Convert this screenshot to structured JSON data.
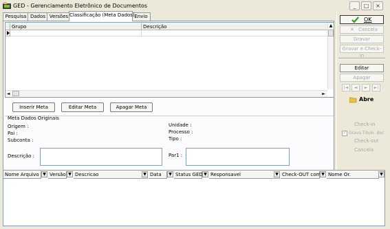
{
  "window": {
    "title": "GED - Gerenciamento Eletrônico de Documentos"
  },
  "tabs": [
    "Pesquisa",
    "Dados",
    "Versões",
    "Classificação (Meta Dados)",
    "Envio"
  ],
  "grid": {
    "columns": [
      "Grupo",
      "Descrição"
    ]
  },
  "meta_buttons": {
    "insert": "Inserir Meta",
    "edit": "Editar Meta",
    "delete": "Apagar Meta"
  },
  "meta_original": {
    "heading": "Meta Dados Originais",
    "origem": "Origem :",
    "pai": "Pai :",
    "subconta": "Subconta :",
    "unidade": "Unidade :",
    "processo": "Processo :",
    "tipo": "Tipo :",
    "descricao": "Descrição :",
    "par1": "Par1 :"
  },
  "right_panel": {
    "ok": "OK",
    "cancel": "Cancela",
    "save": "Gravar",
    "save_checkin": "Gravar e Check-in",
    "edit": "Editar",
    "delete": "Apagar",
    "open": "Abre",
    "checkin": "Check-in",
    "save_title": "Grava Título .doc",
    "checkout": "Check-out",
    "cancel2": "Cancela"
  },
  "bottom_grid": {
    "columns": [
      "Nome Arquivo",
      "Versão",
      "Descricao",
      "Data",
      "Status GED",
      "Responsavel",
      "Check-OUT com",
      "Nome Or."
    ]
  },
  "colors": {
    "window_bg": "#ece9d8",
    "panel_bg": "#fcfcfe",
    "ok_check": "#2e9a2e"
  }
}
